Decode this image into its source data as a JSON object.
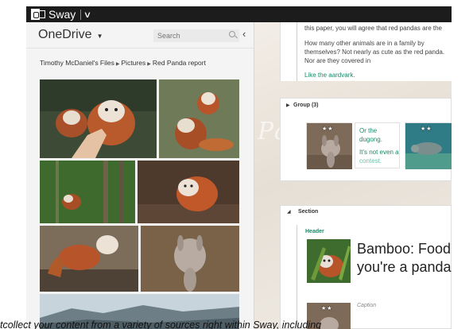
{
  "app": {
    "name": "Sway"
  },
  "onedrive": {
    "title": "OneDrive",
    "search_placeholder": "Search",
    "breadcrumb": [
      "Timothy McDaniel's Files",
      "Pictures",
      "Red Panda report"
    ]
  },
  "canvas": {
    "ghost_text": "Pa",
    "text_card": {
      "line1": "this paper, you will agree that red pandas are the",
      "line2": "How many other animals are in a family by themselves? Not nearly as cute as the red panda. Nor are they covered in",
      "line3": "Like the aardvark."
    },
    "group": {
      "title": "Group (3)",
      "item2_text_a": "Or the",
      "item2_text_b": "dugong.",
      "item2_text_c": "It's not even a",
      "item2_text_d": "contest.",
      "stars": "★★"
    },
    "section": {
      "title": "Section",
      "header_label": "Header",
      "heading_line1": "Bamboo: Food",
      "heading_line2": "you're a panda",
      "caption_label": "Caption",
      "stars": "★★"
    }
  },
  "caption_strip": "tcollect your content from a variety of sources right within Sway, including",
  "colors": {
    "accent": "#1a8a6a",
    "titlebar": "#1c1c1c"
  }
}
